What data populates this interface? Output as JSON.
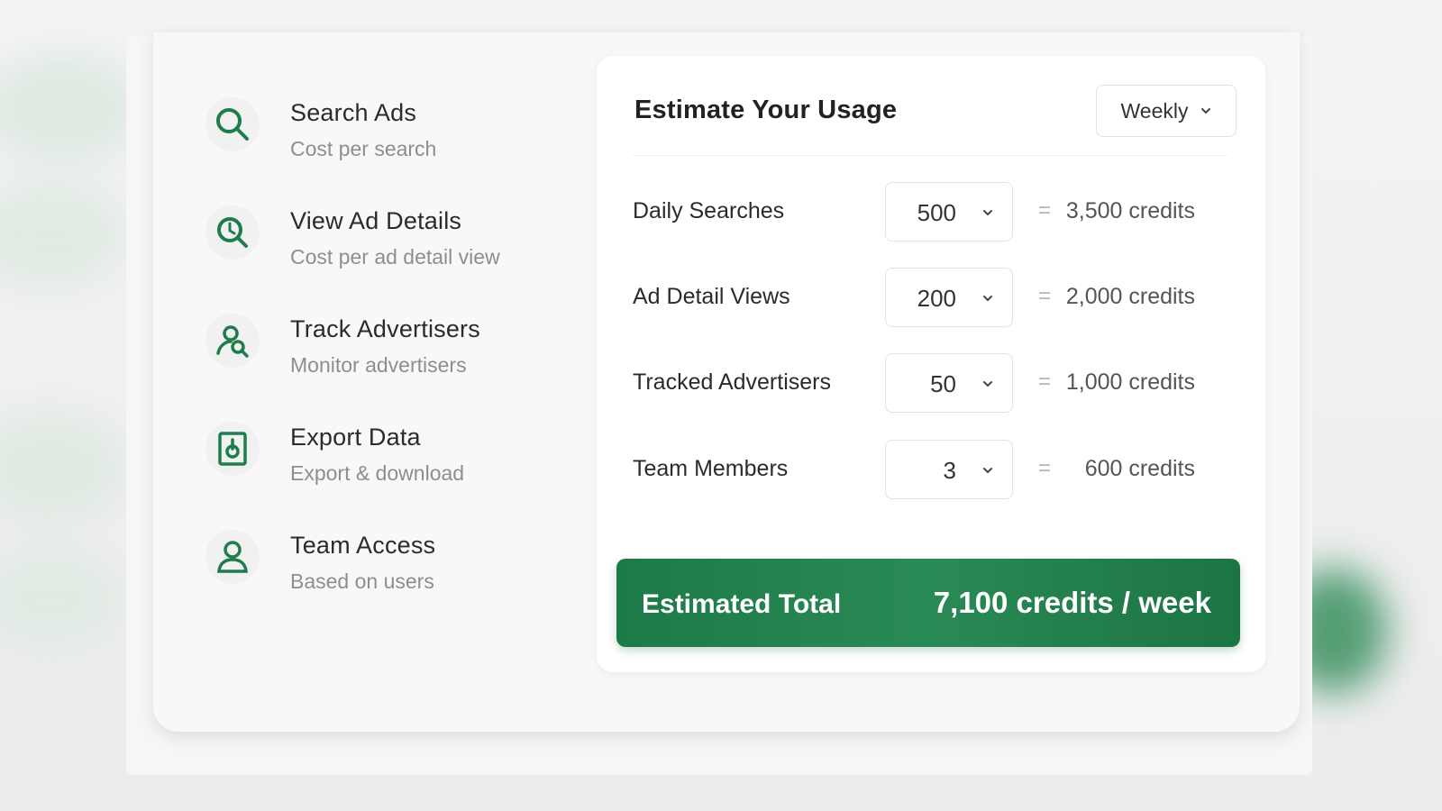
{
  "colors": {
    "accent": "#1d7a48",
    "icon": "#1f7d4c",
    "text_primary": "#2b2b2b",
    "text_secondary": "#8e8e8e"
  },
  "features": [
    {
      "title": "Search Ads",
      "subtitle": "Cost per search",
      "icon": "search-icon"
    },
    {
      "title": "View Ad Details",
      "subtitle": "Cost per ad detail view",
      "icon": "search-detail-icon"
    },
    {
      "title": "Track Advertisers",
      "subtitle": "Monitor advertisers",
      "icon": "user-search-icon"
    },
    {
      "title": "Export Data",
      "subtitle": "Export & download",
      "icon": "export-document-icon"
    },
    {
      "title": "Team Access",
      "subtitle": "Based on users",
      "icon": "user-icon"
    }
  ],
  "estimator": {
    "title": "Estimate Your Usage",
    "period": "Weekly",
    "rows": [
      {
        "label": "Daily Searches",
        "value": "500",
        "equals": "=",
        "credits": "3,500 credits"
      },
      {
        "label": "Ad Detail Views",
        "value": "200",
        "equals": "=",
        "credits": "2,000 credits"
      },
      {
        "label": "Tracked Advertisers",
        "value": "50",
        "equals": "=",
        "credits": "1,000 credits"
      },
      {
        "label": "Team Members",
        "value": "3",
        "equals": "=",
        "credits": "600 credits"
      }
    ],
    "total_label": "Estimated Total",
    "total_value": "7,100 credits / week"
  }
}
